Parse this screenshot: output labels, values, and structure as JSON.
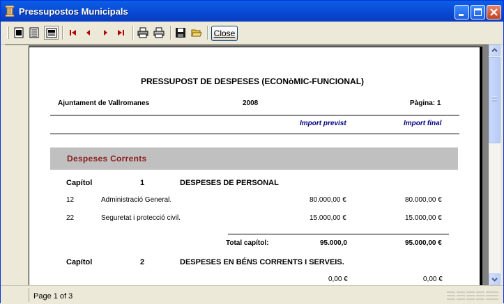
{
  "window": {
    "title": "Pressupostos Municipals"
  },
  "toolbar": {
    "close_label": "Close"
  },
  "report": {
    "title": "PRESSUPOST DE DESPESES (ECONòMIC-FUNCIONAL)",
    "entity": "Ajuntament de Vallromanes",
    "year": "2008",
    "page_label": "Pàgina: 1",
    "col_previst": "Import previst",
    "col_final": "Import final",
    "section": "Despeses Corrents",
    "chapters": [
      {
        "label": "Capítol",
        "number": "1",
        "name": "DESPESES DE PERSONAL",
        "rows": [
          {
            "code": "12",
            "desc": "Administració General.",
            "previst": "80.000,00 €",
            "final": "80.000,00 €"
          },
          {
            "code": "22",
            "desc": "Seguretat i protecció civil.",
            "previst": "15.000,00 €",
            "final": "15.000,00 €"
          }
        ],
        "total_label": "Total capítol:",
        "total_previst": "95.000,0",
        "total_final": "95.000,00 €"
      },
      {
        "label": "Capítol",
        "number": "2",
        "name": "DESPESES EN BÉNS CORRENTS I SERVEIS.",
        "first_row": {
          "previst": "0,00 €",
          "final": "0,00 €"
        }
      }
    ]
  },
  "status": {
    "page_text": "Page 1 of 3"
  },
  "colors": {
    "section_text": "#8B1A1A",
    "section_bg": "#C0C0C0",
    "column_header": "#000080",
    "titlebar": "#0A4FD8"
  }
}
